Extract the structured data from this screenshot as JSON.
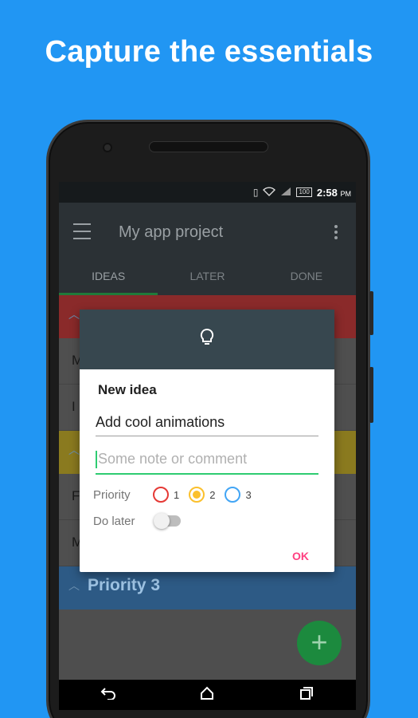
{
  "headline": "Capture the essentials",
  "status_bar": {
    "battery": "100",
    "time": "2:58",
    "ampm": "PM"
  },
  "app_bar": {
    "title": "My app project",
    "tabs": [
      {
        "label": "IDEAS",
        "active": true
      },
      {
        "label": "LATER",
        "active": false
      },
      {
        "label": "DONE",
        "active": false
      }
    ]
  },
  "list": {
    "section1_color": "#8a2a2a",
    "section2_color": "#8a7a1f",
    "section3_label": "Priority 3",
    "section3_color": "#2d5a85",
    "rows": [
      {
        "text": "M"
      },
      {
        "text": "I"
      },
      {
        "text": "F"
      },
      {
        "text": "M"
      }
    ]
  },
  "dialog": {
    "icon": "lightbulb-icon",
    "title": "New idea",
    "title_value": "Add cool animations",
    "note_placeholder": "Some note or comment",
    "priority_label": "Priority",
    "priority_options": [
      {
        "value": "1",
        "color": "#e53935",
        "selected": false
      },
      {
        "value": "2",
        "color": "#fbc02d",
        "selected": true
      },
      {
        "value": "3",
        "color": "#42a5f5",
        "selected": false
      }
    ],
    "do_later_label": "Do later",
    "do_later_on": false,
    "ok_label": "OK"
  },
  "colors": {
    "background": "#2196F3",
    "accent": "#ff4081",
    "fab": "#1c8a3e"
  }
}
